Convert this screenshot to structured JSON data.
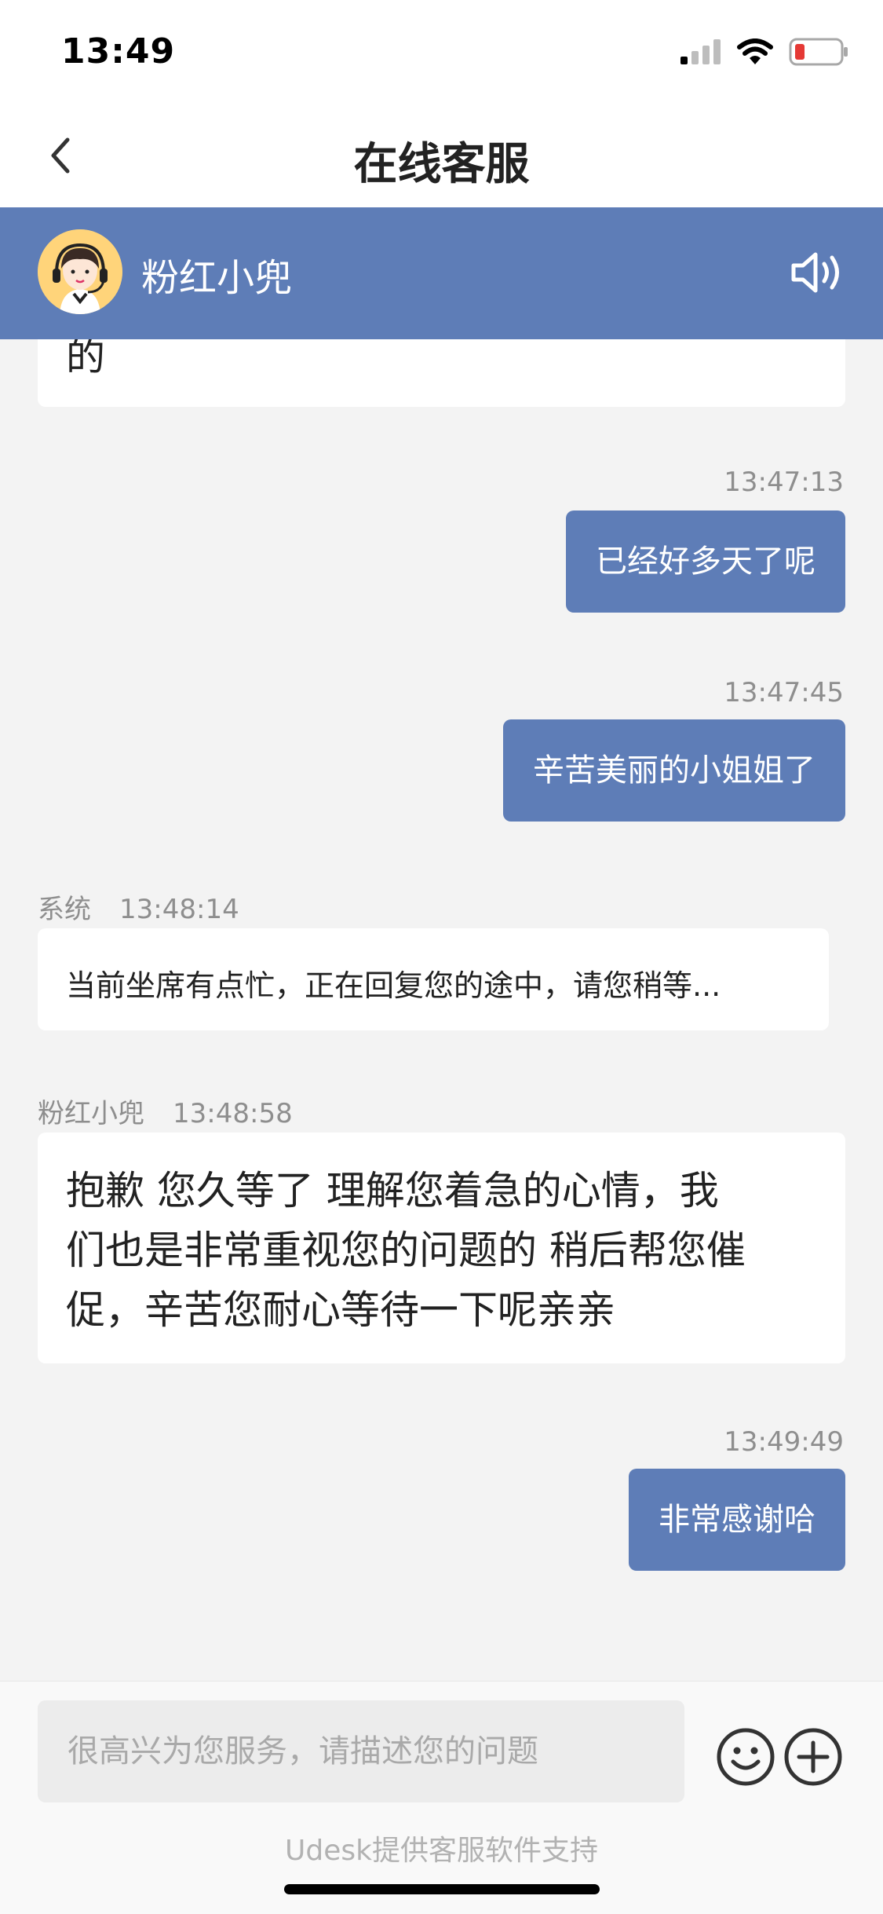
{
  "status_bar": {
    "time": "13:49"
  },
  "nav": {
    "title": "在线客服"
  },
  "agent": {
    "name": "粉红小兜"
  },
  "messages": {
    "partial_agent_text": "的",
    "m1": {
      "time": "13:47:13",
      "text": "已经好多天了呢"
    },
    "m2": {
      "time": "13:47:45",
      "text": "辛苦美丽的小姐姐了"
    },
    "m3": {
      "sender": "系统",
      "time": "13:48:14",
      "text": "当前坐席有点忙，正在回复您的途中，请您稍等..."
    },
    "m4": {
      "sender": "粉红小兜",
      "time": "13:48:58",
      "line1": "抱歉 您久等了 理解您着急的心情，我",
      "line2": "们也是非常重视您的问题的 稍后帮您催",
      "line3": "促，辛苦您耐心等待一下呢亲亲"
    },
    "m5": {
      "time": "13:49:49",
      "text": "非常感谢哈"
    }
  },
  "input": {
    "placeholder": "很高兴为您服务，请描述您的问题"
  },
  "footer": {
    "text": "Udesk提供客服软件支持"
  },
  "colors": {
    "accent": "#5e7db7",
    "background": "#f3f3f3"
  }
}
